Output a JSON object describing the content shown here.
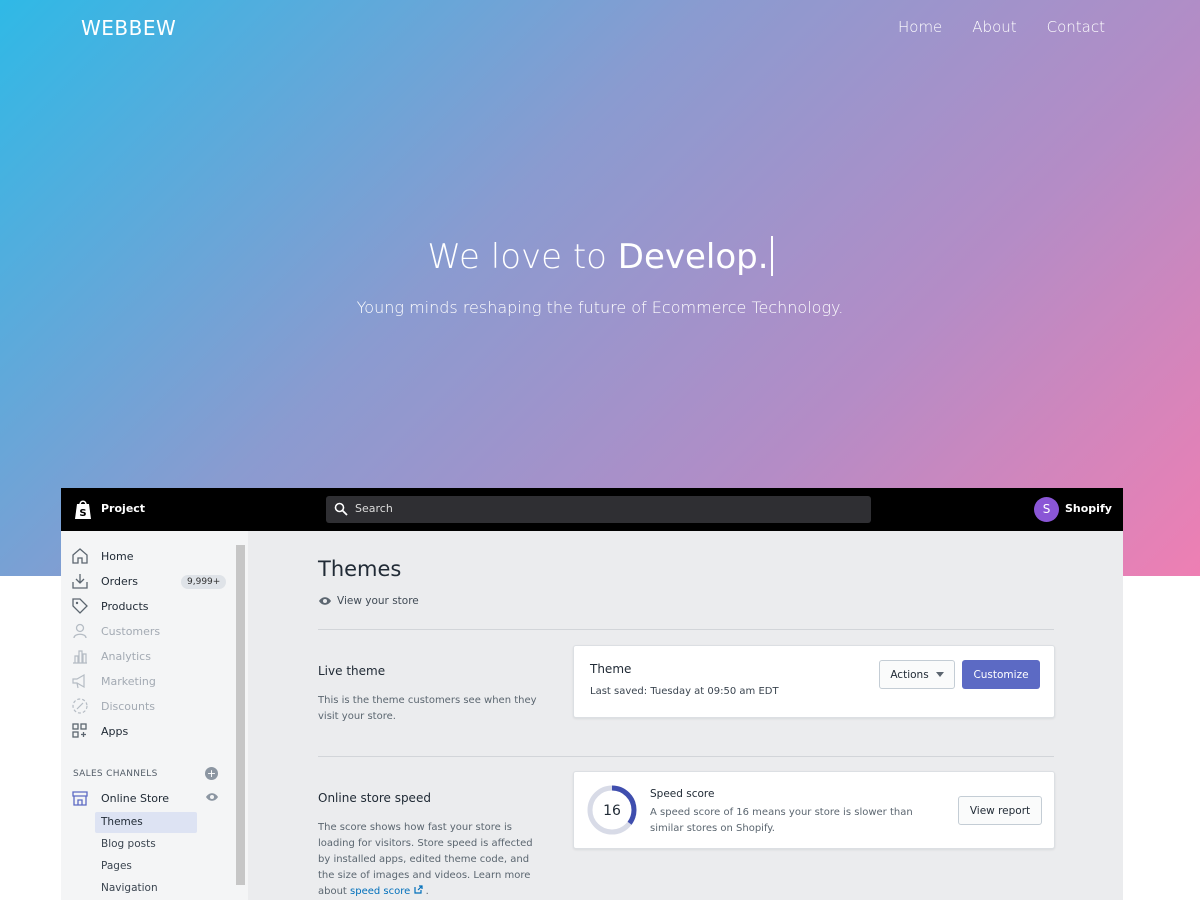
{
  "site": {
    "brand": "WEBBEW",
    "nav": [
      "Home",
      "About",
      "Contact"
    ],
    "hero_title_light": "We love to ",
    "hero_title_bold": "Develop.",
    "hero_subtitle": "Young minds reshaping the future of Ecommerce Technology."
  },
  "admin": {
    "store_name": "Project",
    "search_placeholder": "Search",
    "avatar_initial": "S",
    "account_name": "Shopify",
    "sidebar": {
      "items": [
        {
          "label": "Home",
          "icon": "home-icon",
          "enabled": true
        },
        {
          "label": "Orders",
          "icon": "orders-icon",
          "enabled": true,
          "badge": "9,999+"
        },
        {
          "label": "Products",
          "icon": "tag-icon",
          "enabled": true
        },
        {
          "label": "Customers",
          "icon": "person-icon",
          "enabled": false
        },
        {
          "label": "Analytics",
          "icon": "bar-chart-icon",
          "enabled": false
        },
        {
          "label": "Marketing",
          "icon": "megaphone-icon",
          "enabled": false
        },
        {
          "label": "Discounts",
          "icon": "discount-icon",
          "enabled": false
        },
        {
          "label": "Apps",
          "icon": "apps-icon",
          "enabled": true
        }
      ],
      "sales_channels_title": "SALES CHANNELS",
      "online_store": "Online Store",
      "sub_items": [
        "Themes",
        "Blog posts",
        "Pages",
        "Navigation"
      ],
      "active_sub_item": "Themes"
    },
    "main": {
      "page_title": "Themes",
      "view_store": "View your store",
      "live_theme": {
        "title": "Live theme",
        "description": "This is the theme customers see when they visit your store.",
        "card_title": "Theme",
        "last_saved": "Last saved: Tuesday at 09:50 am EDT",
        "actions_button": "Actions",
        "customize_button": "Customize"
      },
      "speed": {
        "title": "Online store speed",
        "description": "The score shows how fast your store is loading for visitors. Store speed is affected by installed apps, edited theme code, and the size of images and videos. Learn more about",
        "link_text": "speed score",
        "score": "16",
        "score_fraction": 0.16,
        "card_title": "Speed score",
        "card_desc": "A speed score of 16 means your store is slower than similar stores on Shopify.",
        "report_button": "View report"
      }
    }
  },
  "colors": {
    "gradient_start": "#2fb9e6",
    "gradient_end": "#ee7fb3",
    "accent": "#5c6ac4",
    "avatar": "#8a56d6",
    "link": "#006fbb"
  }
}
